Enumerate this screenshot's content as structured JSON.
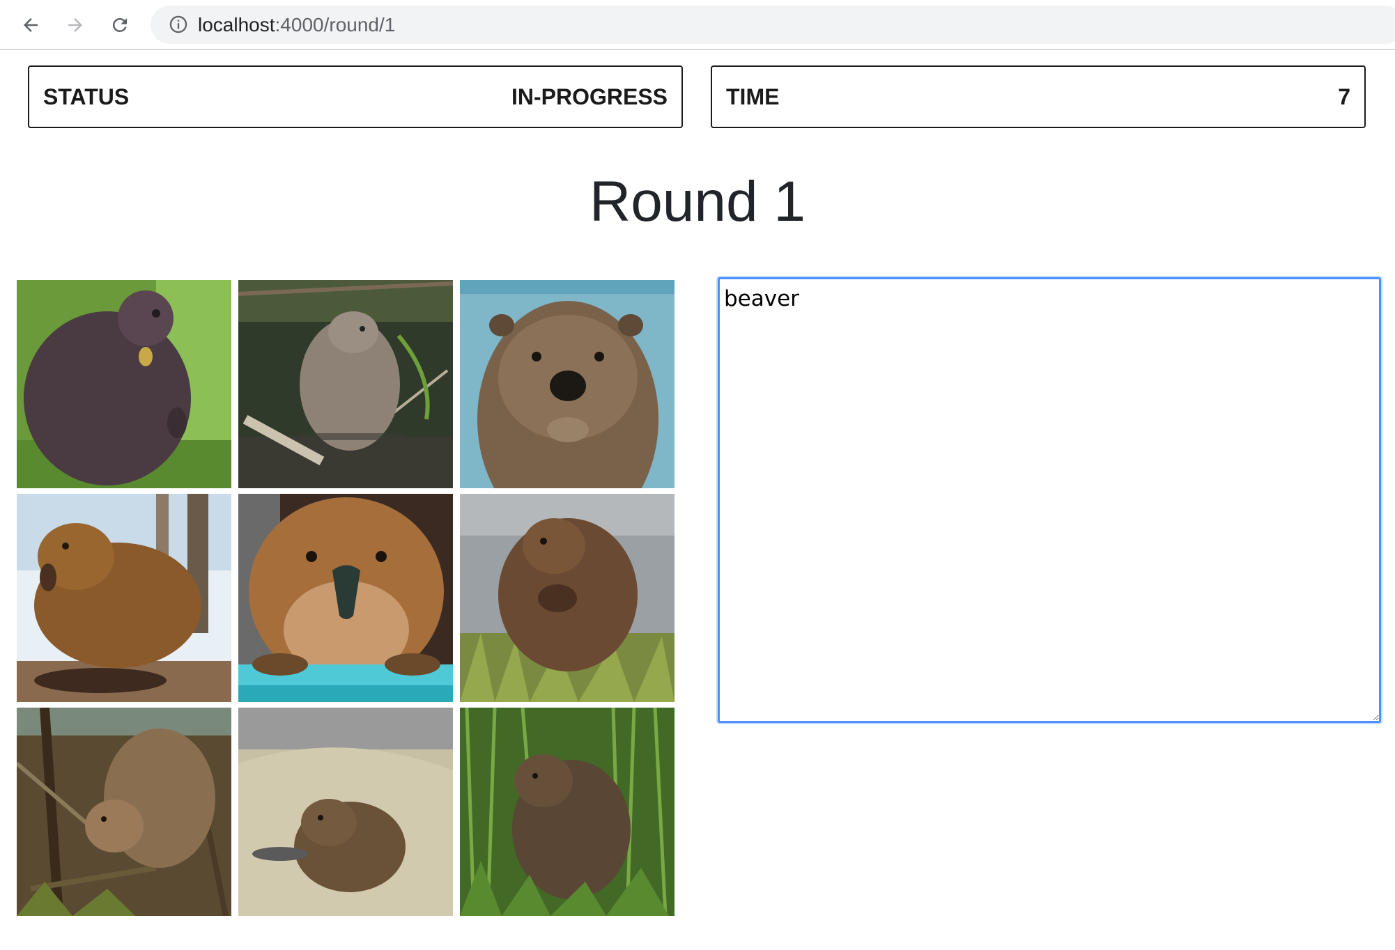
{
  "browser": {
    "url_host": "localhost",
    "url_path": ":4000/round/1"
  },
  "status": {
    "label": "STATUS",
    "value": "IN-PROGRESS"
  },
  "time": {
    "label": "TIME",
    "value": "7"
  },
  "round": {
    "title": "Round 1"
  },
  "images": [
    {
      "subject": "beaver",
      "background": "grass"
    },
    {
      "subject": "beaver",
      "background": "stream"
    },
    {
      "subject": "beaver",
      "background": "water-closeup"
    },
    {
      "subject": "beaver",
      "background": "snow"
    },
    {
      "subject": "beaver",
      "background": "turquoise-ledge"
    },
    {
      "subject": "beaver",
      "background": "road-grass"
    },
    {
      "subject": "beaver",
      "background": "branches"
    },
    {
      "subject": "beaver",
      "background": "hay"
    },
    {
      "subject": "beaver",
      "background": "tall-grass"
    }
  ],
  "answer": {
    "value": "beaver"
  }
}
